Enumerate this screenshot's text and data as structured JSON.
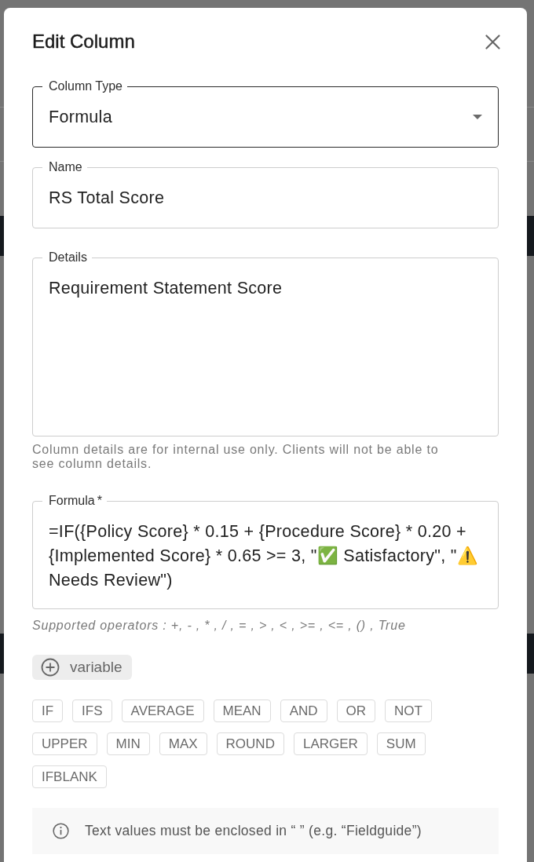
{
  "dialog": {
    "title": "Edit Column",
    "fields": [
      {
        "kind": "select",
        "label": "Column Type",
        "value": "Formula",
        "focused": true
      },
      {
        "kind": "text",
        "label": "Name",
        "value": "RS Total Score",
        "focused": false
      },
      {
        "kind": "textarea",
        "label": "Details",
        "value": "Requirement Statement Score",
        "focused": false,
        "helper": "Column details are for internal use only. Clients will not be able to see column details."
      },
      {
        "kind": "formula",
        "label": "Formula",
        "required_mark": "*",
        "value": "=IF({Policy Score} * 0.15 + {Procedure Score} * 0.20 + {Implemented Score} * 0.65 >= 3, \"✅ Satisfactory\", \"⚠️ Needs Review\")",
        "focused": false,
        "helper": "Supported operators : +, - , * , / , = , > , < , >= , <= , () , True"
      }
    ],
    "variable_button": {
      "label": "variable"
    },
    "functions": [
      "IF",
      "IFS",
      "AVERAGE",
      "MEAN",
      "AND",
      "OR",
      "NOT",
      "UPPER",
      "MIN",
      "MAX",
      "ROUND",
      "LARGER",
      "SUM",
      "IFBLANK"
    ],
    "note": {
      "text": "Text values must be enclosed in “ ” (e.g. “Fieldguide”)"
    }
  }
}
